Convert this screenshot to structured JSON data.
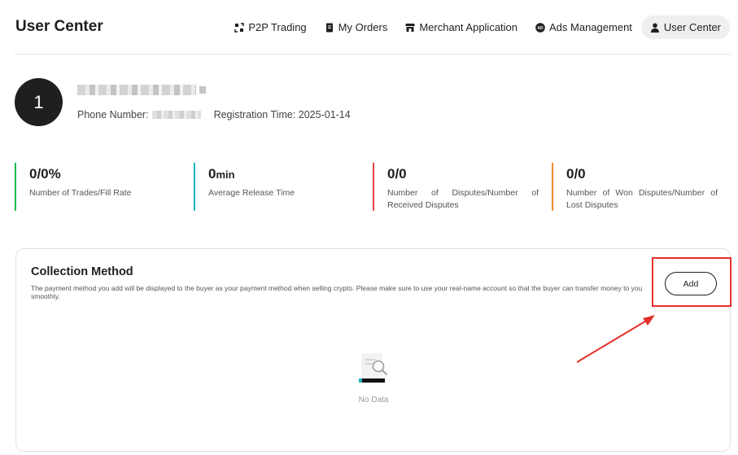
{
  "header": {
    "title": "User Center",
    "nav": [
      {
        "label": "P2P Trading",
        "icon": "p2p-icon"
      },
      {
        "label": "My Orders",
        "icon": "orders-icon"
      },
      {
        "label": "Merchant Application",
        "icon": "store-icon"
      },
      {
        "label": "Ads Management",
        "icon": "ads-icon"
      },
      {
        "label": "User Center",
        "icon": "user-icon",
        "active": true
      }
    ]
  },
  "profile": {
    "avatar_text": "1",
    "phone_label": "Phone Number:",
    "registration_label": "Registration Time: 2025-01-14"
  },
  "stats": [
    {
      "value": "0/0%",
      "unit": "",
      "label": "Number of Trades/Fill Rate",
      "color": "#19b84f"
    },
    {
      "value": "0",
      "unit": "min",
      "label": "Average Release Time",
      "color": "#1fb2b8"
    },
    {
      "value": "0/0",
      "unit": "",
      "label": "Number of Disputes/Number of Received Disputes",
      "color": "#e8434a"
    },
    {
      "value": "0/0",
      "unit": "",
      "label": "Number of Won Disputes/Number of Lost Disputes",
      "color": "#f08a2a"
    }
  ],
  "collection": {
    "title": "Collection Method",
    "description": "The payment method you add will be displayed to the buyer as your payment method when selling crypto. Please make sure to use your real-name account so that the buyer can transfer money to you smoothly.",
    "add_label": "Add",
    "empty_text": "No Data"
  },
  "colors": {
    "annotation": "#e5312b",
    "active_nav_bg": "#efeff1"
  }
}
